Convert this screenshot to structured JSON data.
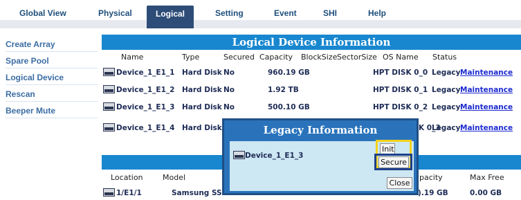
{
  "nav": {
    "tabs": [
      {
        "label": "Global View"
      },
      {
        "label": "Physical"
      },
      {
        "label": "Logical"
      },
      {
        "label": "Setting"
      },
      {
        "label": "Event"
      },
      {
        "label": "SHI"
      },
      {
        "label": "Help"
      }
    ],
    "active_tab": "Logical"
  },
  "sidebar": {
    "items": [
      {
        "label": "Create Array"
      },
      {
        "label": "Spare Pool"
      },
      {
        "label": "Logical Device"
      },
      {
        "label": "Rescan"
      },
      {
        "label": "Beeper Mute"
      }
    ]
  },
  "logical": {
    "title": "Logical Device Information",
    "columns": [
      "Name",
      "Type",
      "Secured",
      "Capacity",
      "BlockSize",
      "SectorSize",
      "OS Name",
      "Status"
    ],
    "rows": [
      {
        "name": "Device_1_E1_1",
        "type": "Hard Disk",
        "secured": "No",
        "capacity": "960.19 GB",
        "os_name": "HPT DISK 0_0",
        "status": "Legacy",
        "action": "Maintenance"
      },
      {
        "name": "Device_1_E1_2",
        "type": "Hard Disk",
        "secured": "No",
        "capacity": "1.92 TB",
        "os_name": "HPT DISK 0_1",
        "status": "Legacy",
        "action": "Maintenance"
      },
      {
        "name": "Device_1_E1_3",
        "type": "Hard Disk",
        "secured": "No",
        "capacity": "500.10 GB",
        "os_name": "HPT DISK 0_2",
        "status": "Legacy",
        "action": "Maintenance"
      },
      {
        "name": "Device_1_E1_4",
        "type": "Hard Disk",
        "os_name_partial": "K 0_3",
        "status": "Legacy",
        "action": "Maintenance"
      }
    ]
  },
  "physical": {
    "columns_visible": [
      "Location",
      "Model",
      "pacity",
      "Max Free"
    ],
    "rows": [
      {
        "location": "1/E1/1",
        "model": "Samsung SSD",
        "capacity_partial": ").19 GB",
        "max_free": "0.00 GB"
      }
    ]
  },
  "modal": {
    "title": "Legacy Information",
    "device_name": "Device_1_E1_3",
    "buttons": {
      "init": "Init",
      "secure": "Secure",
      "close": "Close"
    }
  },
  "colors": {
    "header_blue": "#1887cf",
    "nav_active": "#2d4d78",
    "link_blue": "#3b6da3",
    "highlight_yellow": "#f4d21c",
    "highlight_navy": "#1d3f8a"
  }
}
